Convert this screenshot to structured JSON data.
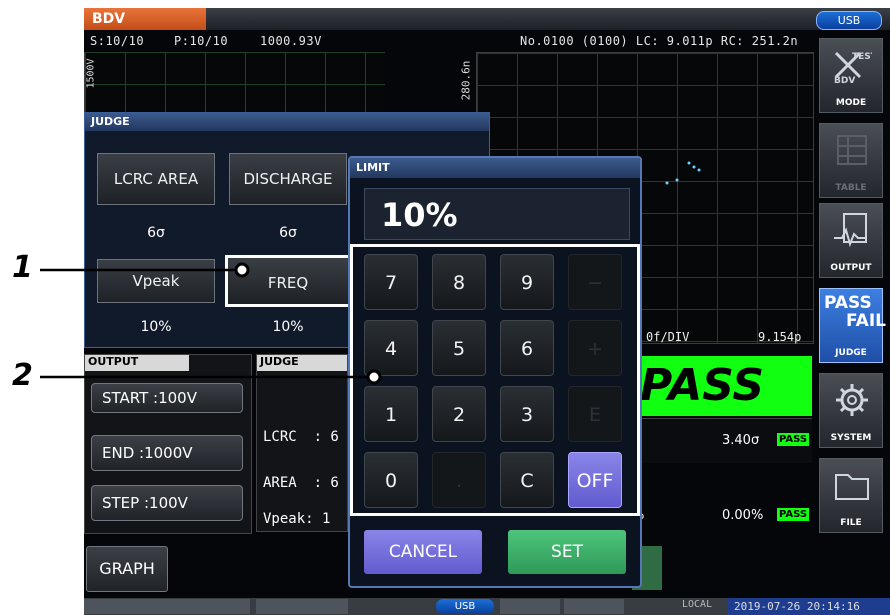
{
  "header": {
    "mode_title": "BDV",
    "usb_label": "USB"
  },
  "status": {
    "s": "S:10/10",
    "p": "P:10/10",
    "voltage": "1000.93V",
    "info": "No.0100 (0100) LC: 9.011p RC: 251.2n"
  },
  "graph_left": {
    "axis_label": "1500V"
  },
  "graph_right": {
    "axis_label": "280.6n",
    "div_label": "0f/DIV",
    "value_label": "9.154p"
  },
  "sidebar": {
    "mode": "MODE",
    "table": "TABLE",
    "output": "OUTPUT",
    "judge": "JUDGE",
    "system": "SYSTEM",
    "file": "FILE",
    "mode_icon_text_test": "TEST",
    "mode_icon_text_bdv": "BDV",
    "judge_icon_pass": "PASS",
    "judge_icon_fail": "FAIL"
  },
  "judge_panel": {
    "title": "JUDGE",
    "buttons": [
      {
        "label": "LCRC AREA",
        "value": "6σ"
      },
      {
        "label": "DISCHARGE",
        "value": "6σ"
      },
      {
        "label": "Vpeak",
        "value": "10%"
      },
      {
        "label": "FREQ",
        "value": "10%"
      }
    ]
  },
  "output_panel": {
    "title": "OUTPUT",
    "start": "START :100V",
    "end": "END   :1000V",
    "step": "STEP  :100V",
    "graph": "GRAPH"
  },
  "judge_result": {
    "title": "JUDGE",
    "rows": [
      "LCRC  : 6",
      "AREA  : 6",
      "Vpeak: 1"
    ],
    "pass_big": "PASS",
    "value1": "3.40σ",
    "value2": "0.00%",
    "partial": "%",
    "badge": "PASS"
  },
  "limit_dialog": {
    "title": "LIMIT",
    "display_value": "10%",
    "keys": [
      "7",
      "8",
      "9",
      "−",
      "4",
      "5",
      "6",
      "+",
      "1",
      "2",
      "3",
      "E",
      "0",
      ".",
      "C",
      "OFF"
    ],
    "cancel": "CANCEL",
    "set": "SET"
  },
  "bottom_bar": {
    "usb": "USB",
    "local": "LOCAL",
    "datetime": "2019-07-26 20:14:16"
  },
  "callouts": {
    "one": "1",
    "two": "2"
  },
  "colors": {
    "accent_orange": "#e06a2c",
    "pass_green": "#11ff11",
    "dialog_blue": "#2f4f86",
    "off_purple": "#7b75e0",
    "set_green": "#3fb06a"
  }
}
